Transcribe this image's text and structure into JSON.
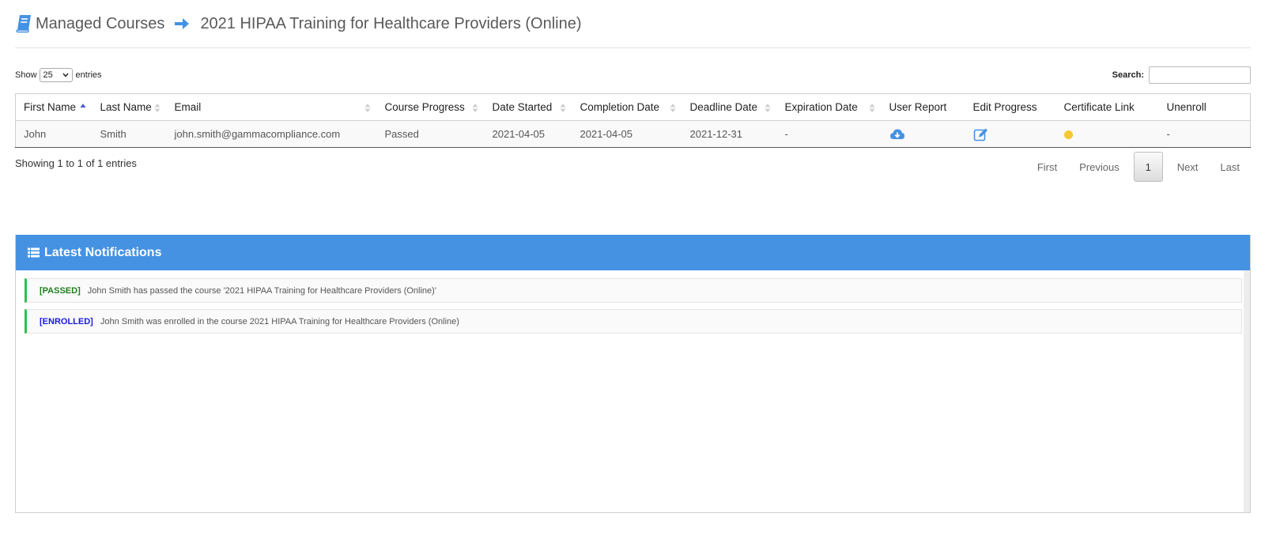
{
  "header": {
    "section": "Managed Courses",
    "course_title": "2021 HIPAA Training for Healthcare Providers (Online)",
    "book_icon": "book-icon",
    "arrow_icon": "arrow-right-icon"
  },
  "controls": {
    "show_label": "Show",
    "page_size": "25",
    "entries_label": "entries",
    "search_label": "Search:",
    "search_value": ""
  },
  "table": {
    "columns": [
      "First Name",
      "Last Name",
      "Email",
      "Course Progress",
      "Date Started",
      "Completion Date",
      "Deadline Date",
      "Expiration Date",
      "User Report",
      "Edit Progress",
      "Certificate Link",
      "Unenroll"
    ],
    "rows": [
      {
        "first_name": "John",
        "last_name": "Smith",
        "email": "john.smith@gammacompliance.com",
        "progress": "Passed",
        "date_started": "2021-04-05",
        "completion_date": "2021-04-05",
        "deadline_date": "2021-12-31",
        "expiration_date": "-",
        "user_report_icon": "cloud-download-icon",
        "edit_progress_icon": "edit-icon",
        "certificate_icon": "status-dot-icon",
        "unenroll": "-"
      }
    ]
  },
  "info": "Showing 1 to 1 of 1 entries",
  "pagination": {
    "first": "First",
    "previous": "Previous",
    "current": "1",
    "next": "Next",
    "last": "Last"
  },
  "notifications": {
    "title": "Latest Notifications",
    "icon": "list-icon",
    "items": [
      {
        "tag": "[PASSED]",
        "text": "John Smith has passed the course '2021 HIPAA Training for Healthcare Providers (Online)'"
      },
      {
        "tag": "[ENROLLED]",
        "text": "John Smith was enrolled in the course 2021 HIPAA Training for Healthcare Providers (Online)"
      }
    ]
  },
  "colors": {
    "accent": "#4592e3",
    "passed": "#27b43e",
    "passed_tag": "#1f7f1f",
    "enrolled_tag": "#1a1ae0",
    "certificate_dot": "#f6c730"
  }
}
